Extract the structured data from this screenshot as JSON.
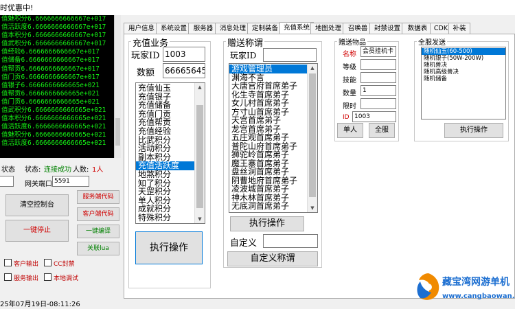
{
  "window": {
    "title": "时优惠中!"
  },
  "console": {
    "lines": [
      "值魅积分6.6666666666667e+017",
      "值活跃度6.6666666666667e+017",
      "值本积分6.6666666666667e+017",
      "值武积分6.6666666666667e+017",
      "值经验6.6666666666667e+017",
      "值储备6.6666666666667e+017",
      "值帮贡6.6666666666667e+017",
      "值门贡6.6666666666667e+017",
      "值银子6.6666666666665e+021",
      "值帮贡6.6666666666665e+021",
      "值门贡6.6666666666665e+021",
      "值武积分6.6666666666665e+021",
      "值本积分6.6666666666665e+021",
      "值活跃度6.6666666666665e+021",
      "值魅积分6.6666666666665e+021",
      "值活跃度6.6666666666665e+021"
    ]
  },
  "left_panel": {
    "status_label": "状态",
    "status_prefix": "状态:",
    "status_value": "连接成功",
    "people_label": "人数:",
    "people_value": "1人",
    "gateway_label": "网关端口",
    "gateway_value": "5591",
    "clear_button": "清空控制台",
    "stop_button": "一键停止",
    "server_code_button": "服务端代码",
    "client_code_button": "客户端代码",
    "compile_button": "一键编译",
    "lua_button": "关联lua",
    "chk_client_output": "客户输出",
    "chk_cc_seal": "CC封禁",
    "chk_server_output": "服务输出",
    "chk_local_debug": "本地调试"
  },
  "tabs": [
    "用户信息",
    "系统设置",
    "服务器",
    "消息处理",
    "定制装备",
    "充值系统",
    "地图处理",
    "召唤兽",
    "封禁设置",
    "数据表",
    "CDK",
    "补装"
  ],
  "active_tab": "充值系统",
  "recharge": {
    "title": "充值业务",
    "player_id_label": "玩家ID",
    "player_id_value": "1003",
    "amount_label": "数额",
    "amount_value": "666656456",
    "items": [
      "充值仙玉",
      "充值银子",
      "充值储备",
      "充值门贡",
      "充值帮贡",
      "充值经验",
      "比武积分",
      "活动积分",
      "副本积分",
      "充值活跃度",
      "地煞积分",
      "知了积分",
      "天罡积分",
      "单人积分",
      "成就积分",
      "特殊积分"
    ],
    "selected": "充值活跃度",
    "execute_button": "执行操作"
  },
  "title_gift": {
    "title": "赠送称谓",
    "player_id_label": "玩家ID",
    "player_id_value": "",
    "items": [
      "游戏管理员",
      "渊海不言",
      "大唐官府首席弟子",
      "化生寺首席弟子",
      "女儿村首席弟子",
      "方寸山首席弟子",
      "天宫首席弟子",
      "龙宫首席弟子",
      "五庄观首席弟子",
      "普陀山府首席弟子",
      "狮驼岭首席弟子",
      "魔王寨首席弟子",
      "盘丝洞首席弟子",
      "阴曹地府首席弟子",
      "凌波城首席弟子",
      "神木林首席弟子",
      "无底洞首席弟子"
    ],
    "selected": "游戏管理员",
    "execute_button": "执行操作",
    "custom_label": "自定义",
    "custom_value": "",
    "custom_button": "自定义称谓"
  },
  "gift_item": {
    "title": "赠送物品",
    "name_label": "名称",
    "name_value": "会员挂机卡",
    "level_label": "等级",
    "level_value": "",
    "skill_label": "技能",
    "skill_value": "",
    "qty_label": "数量",
    "qty_value": "1",
    "limit_label": "限时",
    "limit_value": "",
    "id_label": "ID",
    "id_value": "1003",
    "single_button": "单人",
    "all_button": "全服"
  },
  "server_gift": {
    "title": "全服发送",
    "items": [
      "随机仙玉(60-500)",
      "随机银子(50W-200W)",
      "随机兽决",
      "随机高级兽决",
      "随机储备"
    ],
    "selected": "随机仙玉(60-500)",
    "execute_button": "执行操作"
  },
  "statusbar": {
    "text": "25年07月19日-08:11:26"
  },
  "watermark": {
    "name": "藏宝湾网游单机",
    "url": "www.cangbaowan.net"
  }
}
